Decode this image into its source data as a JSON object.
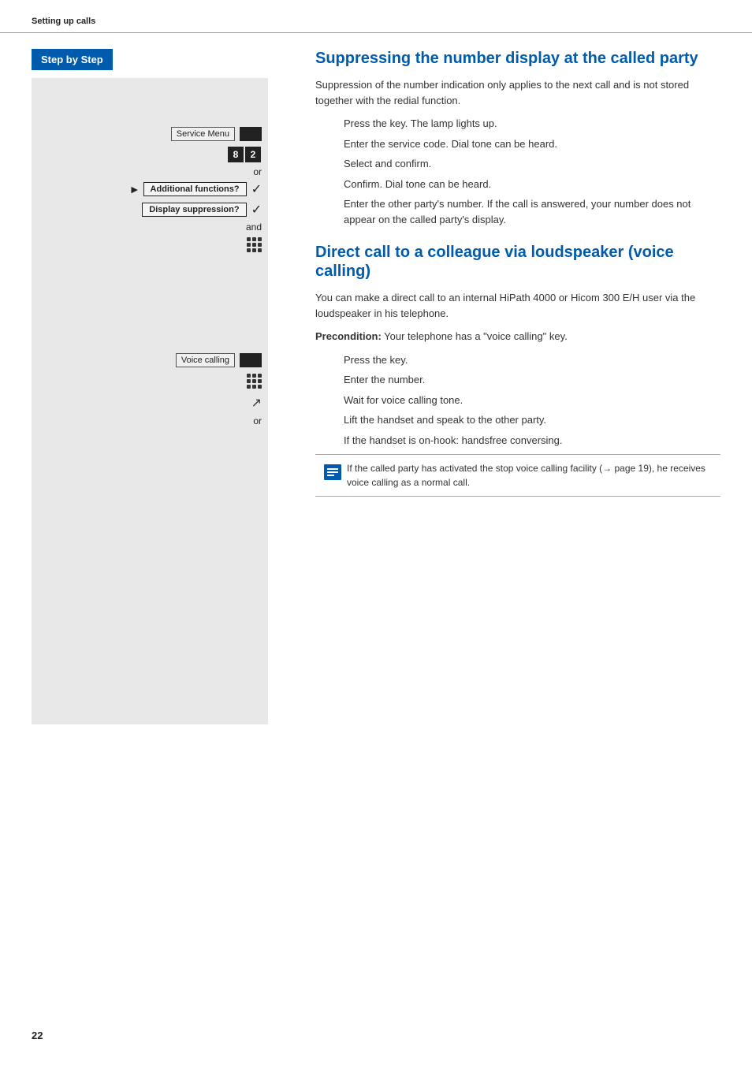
{
  "header": {
    "title": "Setting up calls"
  },
  "sidebar": {
    "step_by_step_label": "Step by Step",
    "service_menu_label": "Service Menu",
    "digits": [
      "8",
      "2"
    ],
    "or_label": "or",
    "additional_functions_label": "Additional functions?",
    "display_suppression_label": "Display suppression?",
    "and_label": "and",
    "voice_calling_label": "Voice calling"
  },
  "section1": {
    "heading": "Suppressing the number display at the called party",
    "body": "Suppression of the number indication only applies to the next call and is not stored together with the redial function.",
    "instructions": [
      {
        "icon": "key-press",
        "text": "Press the key. The lamp lights up."
      },
      {
        "icon": "digits",
        "text": "Enter the service code. Dial tone can be heard."
      },
      {
        "icon": "or",
        "text": ""
      },
      {
        "icon": "check-additional",
        "text": "Select and confirm."
      },
      {
        "icon": "check-display",
        "text": "Confirm. Dial tone can be heard."
      },
      {
        "icon": "and",
        "text": ""
      },
      {
        "icon": "keypad",
        "text": "Enter the other party's number. If the call is answered, your number does not appear on the called party's display."
      }
    ]
  },
  "section2": {
    "heading": "Direct call to a colleague via loudspeaker (voice calling)",
    "body": "You can make a direct call to an internal HiPath 4000 or Hicom 300 E/H user via the loudspeaker in his telephone.",
    "precondition_label": "Precondition:",
    "precondition_text": "Your telephone has a \"voice calling\" key.",
    "instructions": [
      {
        "icon": "key-press",
        "text": "Press the key."
      },
      {
        "icon": "keypad",
        "text": "Enter the number."
      },
      {
        "icon": "none",
        "text": "Wait for voice calling tone."
      },
      {
        "icon": "handset",
        "text": "Lift the handset and speak to the other party."
      },
      {
        "icon": "or",
        "text": ""
      },
      {
        "icon": "none",
        "text": "If the handset is on-hook: handsfree conversing."
      }
    ],
    "note": "If the called party has activated the stop voice calling facility (→ page 19), he receives voice calling as a normal call."
  },
  "page_number": "22"
}
